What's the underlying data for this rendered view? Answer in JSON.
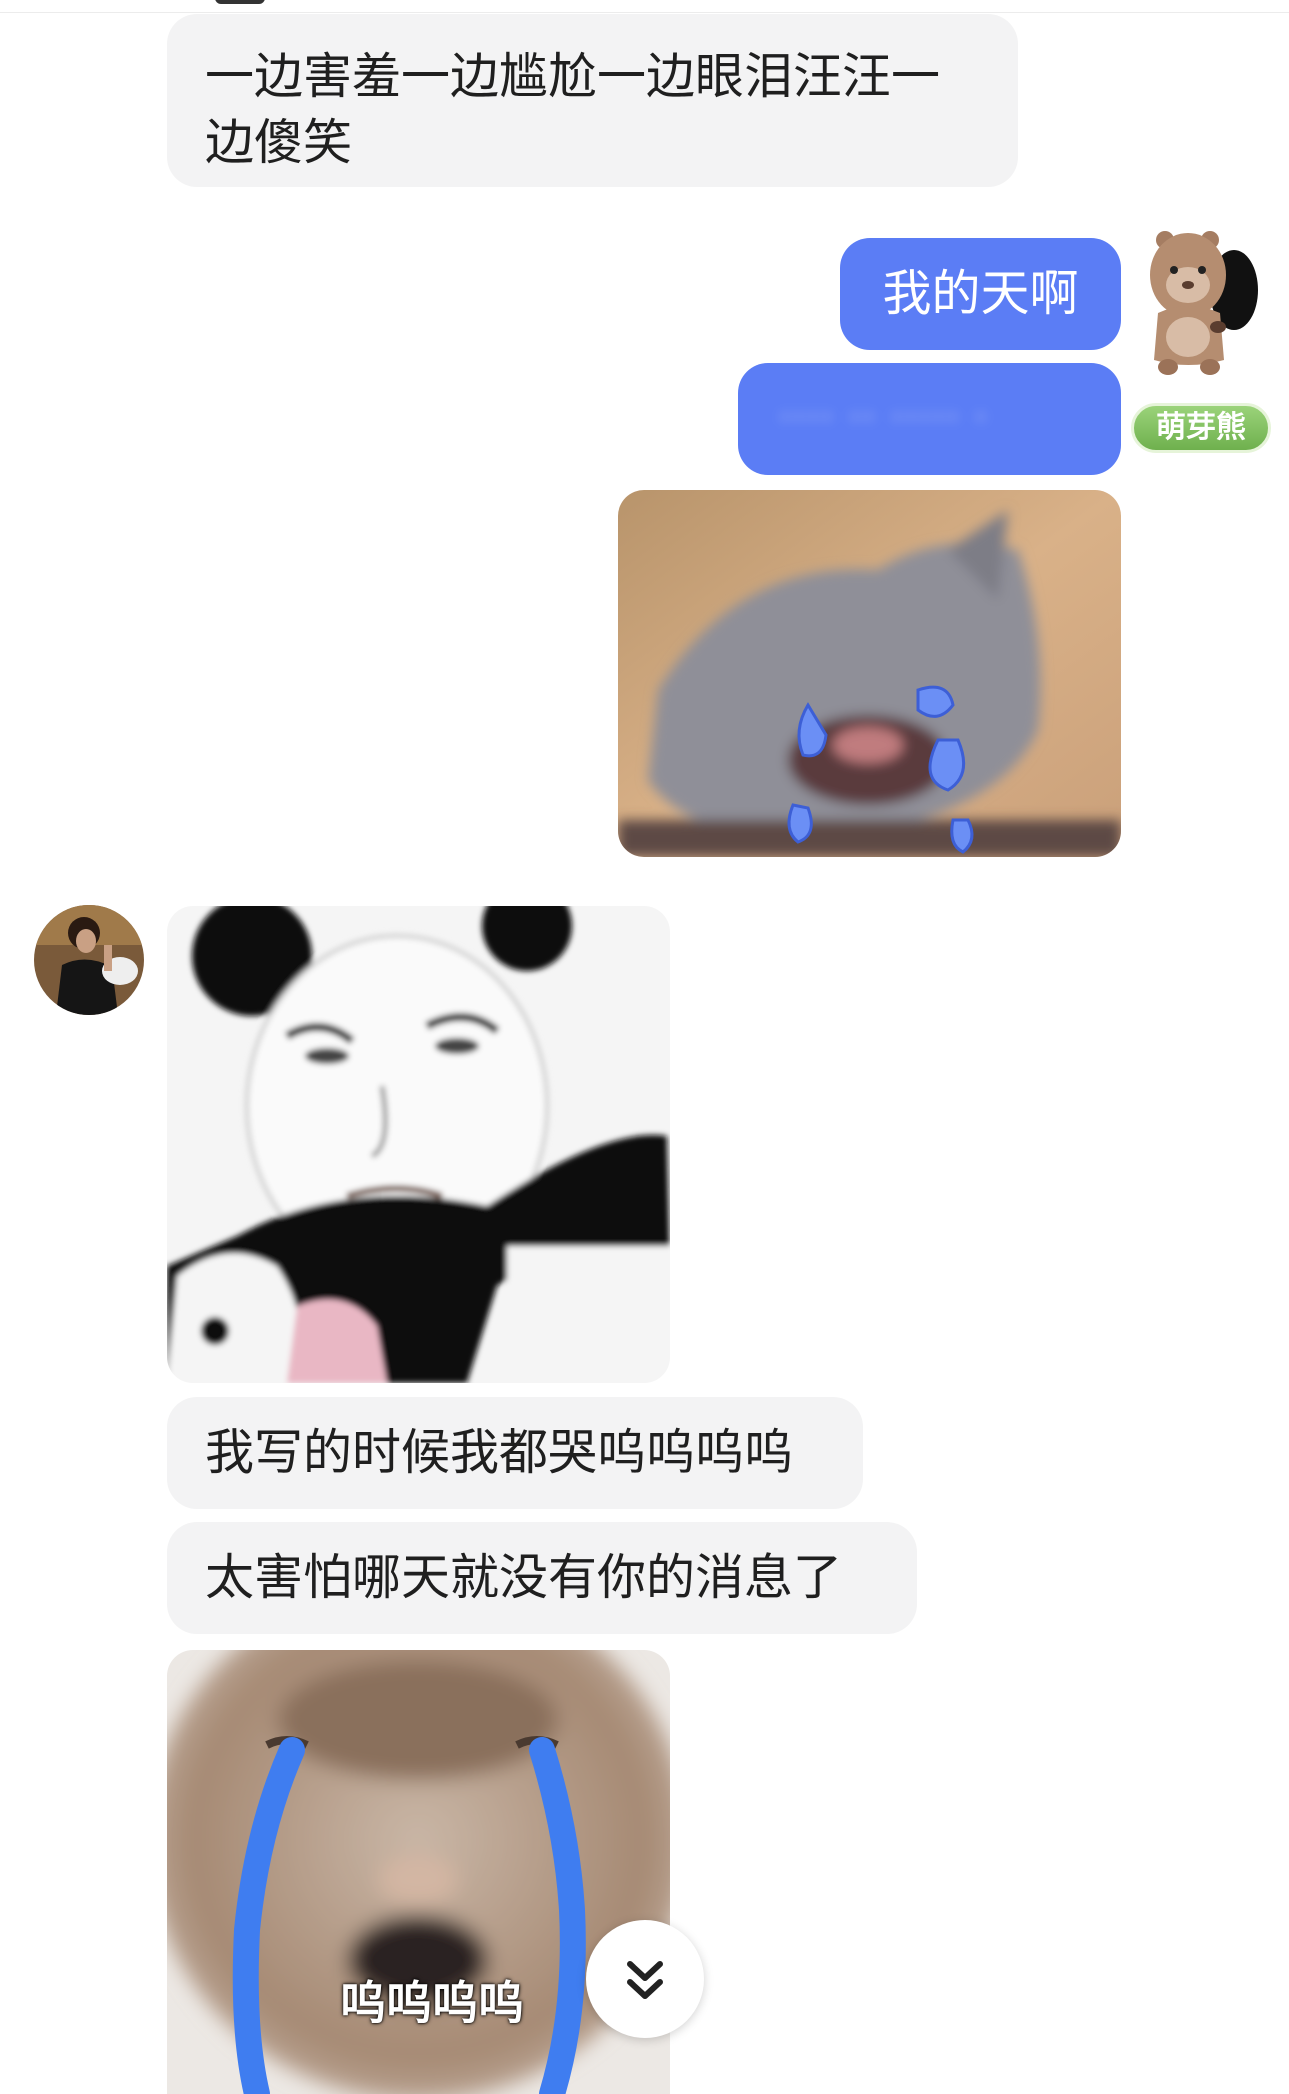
{
  "messages": {
    "m1": "一边害羞一边尴尬一边眼泪汪汪一边傻笑",
    "m2": "我的天啊",
    "m3_blurred": "···· ·· ····· ·",
    "m4": "我写的时候我都哭呜呜呜呜",
    "m5": "太害怕哪天就没有你的消息了"
  },
  "images": {
    "crying_cat": "crying-cat-sticker",
    "panda_face": "panda-face-sticker",
    "tearful_cat": "tearful-cat-sticker",
    "tearful_cat_caption": "呜呜呜呜"
  },
  "self": {
    "badge": "萌芽熊",
    "avatar_icon": "capybara-avatar"
  },
  "other": {
    "avatar_icon": "person-photo-avatar"
  },
  "controls": {
    "scroll_down_icon": "double-chevron-down-icon",
    "scroll_down_glyph": "⌄"
  },
  "colors": {
    "outgoing_bubble": "#5b7df5",
    "incoming_bubble": "#f3f3f4",
    "badge_green": "#7fbf5c"
  }
}
